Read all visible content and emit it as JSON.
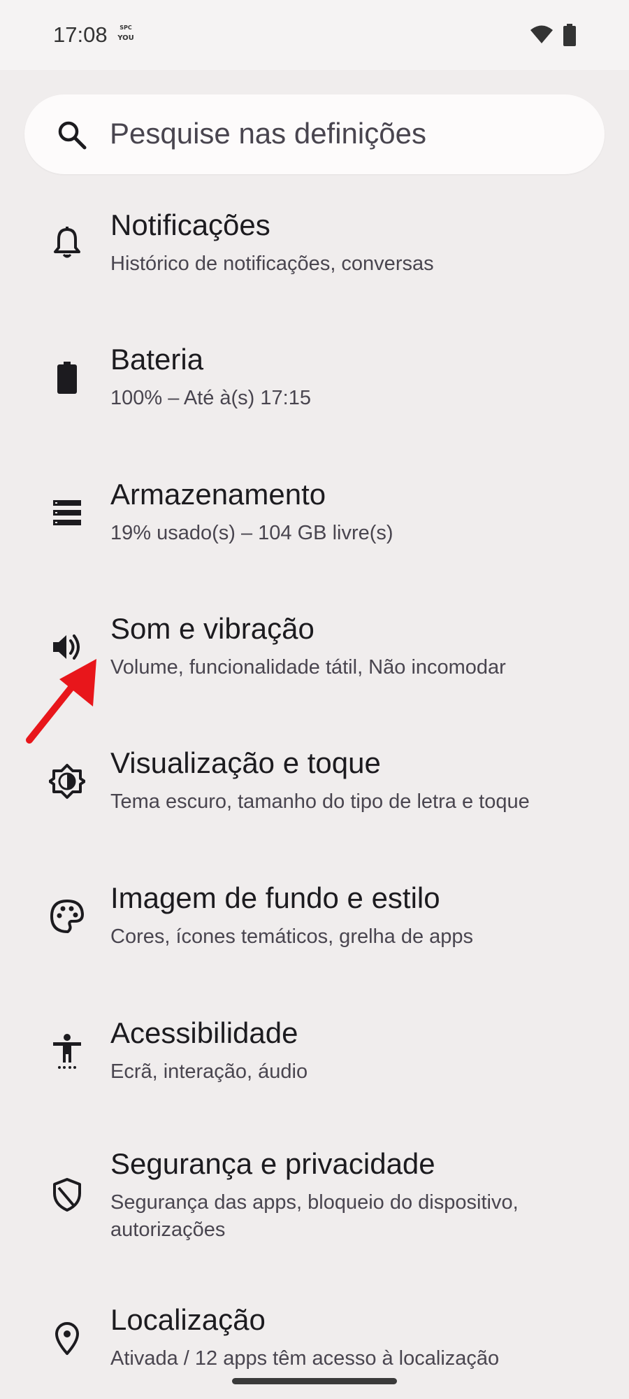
{
  "status_bar": {
    "time": "17:08",
    "badge_top": "SPC",
    "badge_bottom": "YOU",
    "wifi_icon": "wifi-icon",
    "battery_icon": "battery-full-icon"
  },
  "search": {
    "placeholder": "Pesquise nas definições",
    "icon": "search-icon"
  },
  "items": [
    {
      "title": "Notificações",
      "subtitle": "Histórico de notificações, conversas",
      "icon": "bell-icon"
    },
    {
      "title": "Bateria",
      "subtitle": "100% – Até à(s) 17:15",
      "icon": "battery-icon"
    },
    {
      "title": "Armazenamento",
      "subtitle": "19% usado(s) – 104 GB livre(s)",
      "icon": "storage-icon"
    },
    {
      "title": "Som e vibração",
      "subtitle": "Volume, funcionalidade tátil, Não incomodar",
      "icon": "volume-icon"
    },
    {
      "title": "Visualização e toque",
      "subtitle": "Tema escuro, tamanho do tipo de letra e toque",
      "icon": "brightness-icon"
    },
    {
      "title": "Imagem de fundo e estilo",
      "subtitle": "Cores, ícones temáticos, grelha de apps",
      "icon": "palette-icon"
    },
    {
      "title": "Acessibilidade",
      "subtitle": "Ecrã, interação, áudio",
      "icon": "accessibility-icon"
    },
    {
      "title": "Segurança e privacidade",
      "subtitle": "Segurança das apps, bloqueio do dispositivo, autorizações",
      "icon": "shield-icon"
    },
    {
      "title": "Localização",
      "subtitle": "Ativada / 12 apps têm acesso à localização",
      "icon": "location-pin-icon"
    }
  ],
  "annotation": {
    "arrow_color": "#e8161b",
    "icon": "red-arrow-annotation"
  },
  "colors": {
    "background": "#f0eded",
    "search_background": "#fdfbfb",
    "title_text": "#1c1b1f",
    "subtitle_text": "#49454f"
  }
}
